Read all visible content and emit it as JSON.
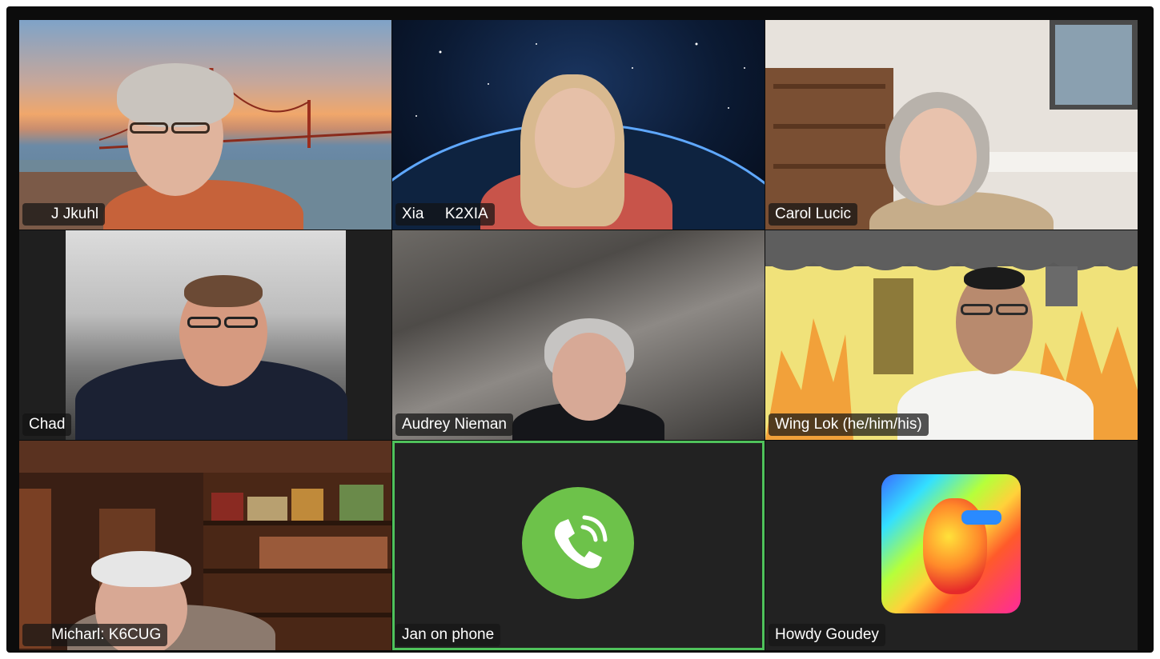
{
  "meeting": {
    "participants": [
      {
        "name": "J Jkuhl",
        "muted": true
      },
      {
        "name": "Xia     K2XIA",
        "muted": false
      },
      {
        "name": "Carol Lucic",
        "muted": false
      },
      {
        "name": "Chad",
        "muted": false
      },
      {
        "name": "Audrey Nieman",
        "muted": false
      },
      {
        "name": "Wing Lok (he/him/his)",
        "muted": false
      },
      {
        "name": "Micharl: K6CUG",
        "muted": true
      },
      {
        "name": "Jan on phone",
        "muted": false,
        "phone": true,
        "active_speaker": true
      },
      {
        "name": "Howdy Goudey",
        "muted": false,
        "avatar": "thermal-portrait"
      }
    ]
  },
  "colors": {
    "active_border": "#4fc25b",
    "phone_circle": "#6dc24a",
    "mute_red": "#e0483e",
    "tile_bg": "#1f1f1f"
  },
  "icons": {
    "mute": "microphone-muted-icon",
    "phone": "phone-call-icon"
  }
}
